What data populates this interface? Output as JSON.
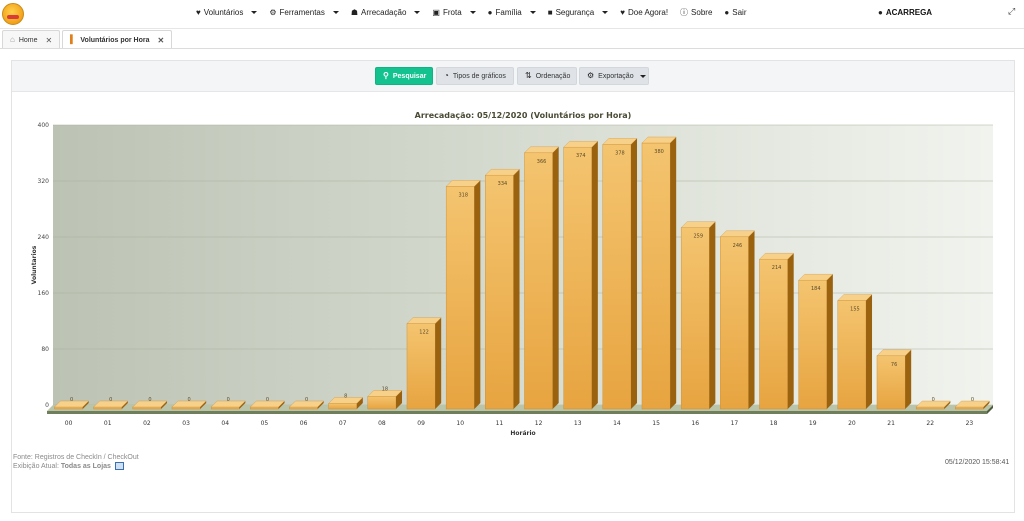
{
  "nav": {
    "items": [
      {
        "label": "Voluntários",
        "icon": "heart-icon",
        "caret": true
      },
      {
        "label": "Ferramentas",
        "icon": "gear-icon",
        "caret": true
      },
      {
        "label": "Arrecadação",
        "icon": "cart-icon",
        "caret": true
      },
      {
        "label": "Frota",
        "icon": "bus-icon",
        "caret": true
      },
      {
        "label": "Família",
        "icon": "users-icon",
        "caret": true
      },
      {
        "label": "Segurança",
        "icon": "lock-icon",
        "caret": true
      },
      {
        "label": "Doe Agora!",
        "icon": "heart-icon",
        "caret": false
      },
      {
        "label": "Sobre",
        "icon": "info-icon",
        "caret": false
      },
      {
        "label": "Sair",
        "icon": "user-icon",
        "caret": false
      }
    ],
    "user": "ACARREGA"
  },
  "tabs": [
    {
      "label": "Home",
      "icon": "home-icon"
    },
    {
      "label": "Voluntários por Hora",
      "icon": "bar-chart-icon"
    }
  ],
  "toolbar": {
    "search": "Pesquisar",
    "chart_types": "Tipos de gráficos",
    "sort": "Ordenação",
    "export": "Exportação"
  },
  "footer": {
    "source": "Fonte: Registros de CheckIn / CheckOut",
    "display_label": "Exibição Atual:",
    "display_value": "Todas as Lojas",
    "timestamp": "05/12/2020 15:58:41"
  },
  "colors": {
    "accent": "#13c28f",
    "bar": "#f0b457",
    "bar_dark": "#9a620f",
    "bar_top": "#f7d089"
  },
  "chart_data": {
    "type": "bar",
    "title": "Arrecadação: 05/12/2020 (Voluntários por Hora)",
    "xlabel": "Horário",
    "ylabel": "Voluntarios",
    "categories": [
      "00",
      "01",
      "02",
      "03",
      "04",
      "05",
      "06",
      "07",
      "08",
      "09",
      "10",
      "11",
      "12",
      "13",
      "14",
      "15",
      "16",
      "17",
      "18",
      "19",
      "20",
      "21",
      "22",
      "23"
    ],
    "values": [
      0,
      0,
      0,
      0,
      0,
      0,
      0,
      8,
      18,
      122,
      318,
      334,
      366,
      374,
      378,
      380,
      259,
      246,
      214,
      184,
      155,
      76,
      0,
      0
    ],
    "ylim": [
      0,
      400
    ],
    "yticks": [
      0,
      80,
      160,
      240,
      320,
      400
    ],
    "grid": true
  }
}
